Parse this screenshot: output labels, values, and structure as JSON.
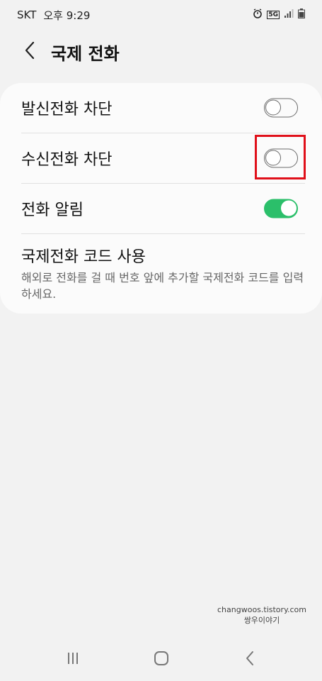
{
  "status_bar": {
    "carrier": "SKT",
    "time": "오후 9:29",
    "network": "5G",
    "icons": [
      "alarm-icon",
      "5g-icon",
      "signal-icon",
      "battery-icon"
    ]
  },
  "header": {
    "back_icon": "chevron-left-icon",
    "title": "국제 전화"
  },
  "settings": {
    "items": [
      {
        "label": "발신전화 차단",
        "toggle": "off"
      },
      {
        "label": "수신전화 차단",
        "toggle": "off"
      },
      {
        "label": "전화 알림",
        "toggle": "on"
      }
    ],
    "intl_code": {
      "title": "국제전화 코드 사용",
      "description": "해외로 전화를 걸 때 번호 앞에 추가할 국제전화 코드를 입력하세요."
    }
  },
  "watermark": {
    "line1": "changwoos.tistory.com",
    "line2": "쌍우이야기"
  },
  "nav_bar": {
    "icons": [
      "recent-apps-icon",
      "home-icon",
      "back-icon"
    ]
  },
  "colors": {
    "toggle_on": "#2bbf6a",
    "highlight": "#e0101a",
    "background": "#f2f2f2",
    "card": "#fbfbfb"
  }
}
